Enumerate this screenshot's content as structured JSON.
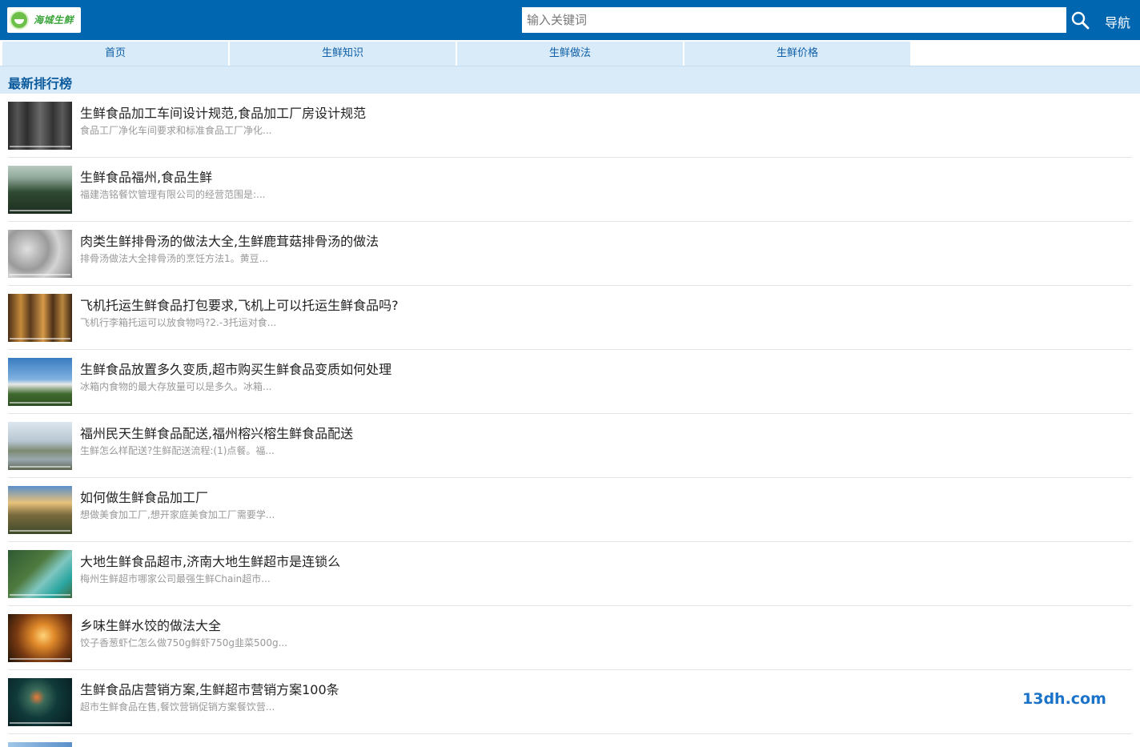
{
  "header": {
    "logo_text": "海城生鲜",
    "search_placeholder": "输入关键词",
    "nav_label": "导航",
    "accent_color": "#0066b0"
  },
  "menu": [
    {
      "label": "首页"
    },
    {
      "label": "生鲜知识"
    },
    {
      "label": "生鲜做法"
    },
    {
      "label": "生鲜价格"
    }
  ],
  "section": {
    "title": "最新排行榜"
  },
  "articles": [
    {
      "title": "生鲜食品加工车间设计规范,食品加工厂房设计规范",
      "desc": "食品工厂净化车间要求和标准食品工厂净化...",
      "thumb": "bare-forest-thumbnail"
    },
    {
      "title": "生鲜食品福州,食品生鲜",
      "desc": "福建浩铭餐饮管理有限公司的经营范围是:...",
      "thumb": "pine-forest-thumbnail"
    },
    {
      "title": "肉类生鲜排骨汤的做法大全,生鲜鹿茸菇排骨汤的做法",
      "desc": "排骨汤做法大全排骨汤的烹饪方法1。黄豆...",
      "thumb": "frost-texture-thumbnail"
    },
    {
      "title": "飞机托运生鲜食品打包要求,飞机上可以托运生鲜食品吗?",
      "desc": "飞机行李箱托运可以放食物吗?2.-3托运对食...",
      "thumb": "autumn-forest-thumbnail"
    },
    {
      "title": "生鲜食品放置多久变质,超市购买生鲜食品变质如何处理",
      "desc": "冰箱内食物的最大存放量可以是多久。冰箱...",
      "thumb": "church-thumbnail"
    },
    {
      "title": "福州民天生鲜食品配送,福州榕兴榕生鲜食品配送",
      "desc": "生鲜怎么样配送?生鲜配送流程:(1)点餐。福...",
      "thumb": "lake-thumbnail"
    },
    {
      "title": "如何做生鲜食品加工厂",
      "desc": "想做美食加工厂,想开家庭美食加工厂需要学...",
      "thumb": "sunset-hill-thumbnail"
    },
    {
      "title": "大地生鲜食品超市,济南大地生鲜超市是连锁么",
      "desc": "梅州生鲜超市哪家公司最强生鲜Chain超市...",
      "thumb": "coast-aerial-thumbnail"
    },
    {
      "title": "乡味生鲜水饺的做法大全",
      "desc": "饺子香葱虾仁怎么做750g鲜虾750g韭菜500g...",
      "thumb": "orange-sunset-thumbnail"
    },
    {
      "title": "生鲜食品店营销方案,生鲜超市营销方案100条",
      "desc": "超市生鲜食品在售,餐饮营销促销方案餐饮营...",
      "thumb": "jellyfish-thumbnail"
    }
  ],
  "watermark": "13dh.com"
}
